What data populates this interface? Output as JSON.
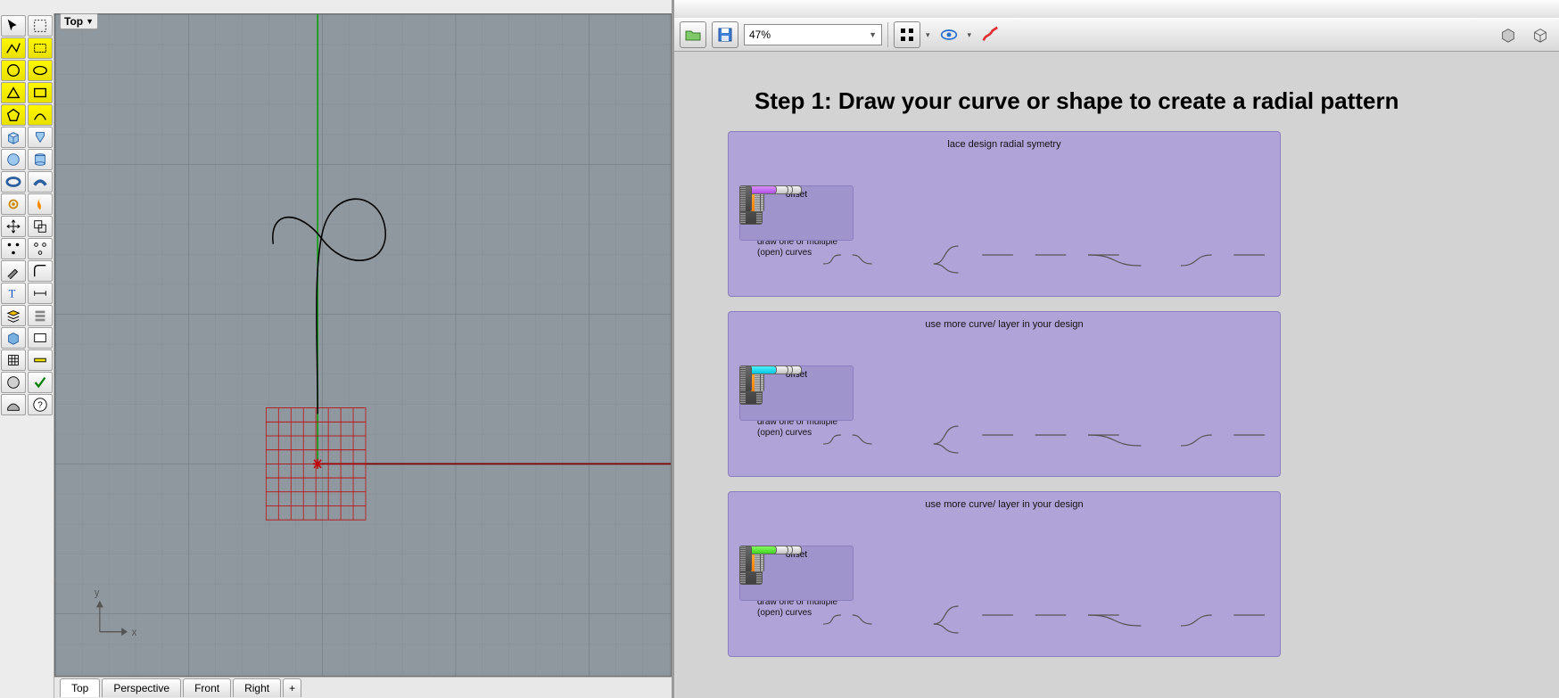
{
  "rhino": {
    "viewport_label": "Top",
    "axis_x": "x",
    "axis_y": "y",
    "tabs": [
      "Top",
      "Perspective",
      "Front",
      "Right"
    ],
    "tab_plus": "+",
    "tool_names": [
      [
        "pointer",
        "lasso-select"
      ],
      [
        "polyline",
        "rect-select"
      ],
      [
        "circle",
        "ellipse"
      ],
      [
        "triangle",
        "rectangle"
      ],
      [
        "polygon",
        "arc"
      ],
      [
        "box",
        "extrude"
      ],
      [
        "sphere",
        "cylinder"
      ],
      [
        "torus",
        "pipe"
      ],
      [
        "gear",
        "flame"
      ],
      [
        "move",
        "copy"
      ],
      [
        "points-on",
        "points-off"
      ],
      [
        "knife",
        "fillet"
      ],
      [
        "text",
        "dimension"
      ],
      [
        "layers",
        "stack"
      ],
      [
        "block",
        "info"
      ],
      [
        "grid",
        "units"
      ],
      [
        "render",
        "check"
      ],
      [
        "surface",
        "help"
      ]
    ]
  },
  "gh": {
    "zoom": "47%",
    "title": "Step 1: Draw your curve or shape to create a radial pattern",
    "clusters": [
      {
        "title": "lace design radial symetry",
        "note": "draw one or multiple (open) curves",
        "sub_label": "offset",
        "tail": "purple"
      },
      {
        "title": "use more curve/ layer in your design",
        "note": "draw one or multiple (open) curves",
        "sub_label": "offset",
        "tail": "cyan"
      },
      {
        "title": "use more curve/ layer in your design",
        "note": "draw one or multiple (open) curves",
        "sub_label": "offset",
        "tail": "green"
      }
    ]
  }
}
